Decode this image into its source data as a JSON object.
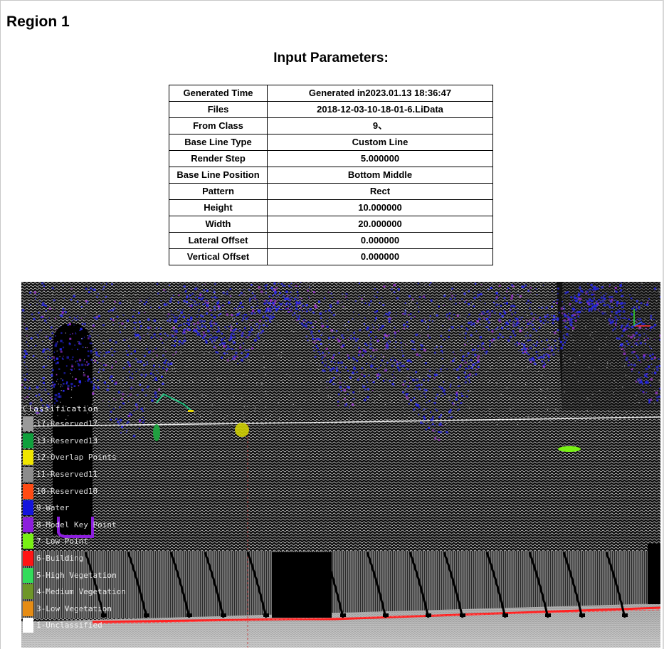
{
  "region": {
    "title": "Region 1"
  },
  "params": {
    "heading": "Input Parameters:",
    "rows": [
      {
        "key": "Generated Time",
        "value": "Generated in2023.01.13 18:36:47"
      },
      {
        "key": "Files",
        "value": "2018-12-03-10-18-01-6.LiData"
      },
      {
        "key": "From Class",
        "value": "9、"
      },
      {
        "key": "Base Line Type",
        "value": "Custom Line"
      },
      {
        "key": "Render Step",
        "value": "5.000000"
      },
      {
        "key": "Base Line Position",
        "value": "Bottom Middle"
      },
      {
        "key": "Pattern",
        "value": "Rect"
      },
      {
        "key": "Height",
        "value": "10.000000"
      },
      {
        "key": "Width",
        "value": "20.000000"
      },
      {
        "key": "Lateral Offset",
        "value": "0.000000"
      },
      {
        "key": "Vertical Offset",
        "value": "0.000000"
      }
    ]
  },
  "viewer": {
    "legend": {
      "title": "Classification",
      "items": [
        {
          "label": "17-Reserved17",
          "color": "#9a9a9a"
        },
        {
          "label": "13-Reserved13",
          "color": "#0fa03c"
        },
        {
          "label": "12-Overlap Points",
          "color": "#f0e600"
        },
        {
          "label": "11-Reserved11",
          "color": "#8c8c8c"
        },
        {
          "label": "10-Reserved10",
          "color": "#ff4b14"
        },
        {
          "label": "9-Water",
          "color": "#1414dc"
        },
        {
          "label": "8-Model Key Point",
          "color": "#8c1edc"
        },
        {
          "label": "7-Low Point",
          "color": "#78f014"
        },
        {
          "label": "6-Building",
          "color": "#ff1414"
        },
        {
          "label": "5-High Vegetation",
          "color": "#32dc5a"
        },
        {
          "label": "4-Medium Vegetation",
          "color": "#6e9628"
        },
        {
          "label": "3-Low Vegetation",
          "color": "#e68c14"
        },
        {
          "label": "1-Unclassified",
          "color": "#ffffff"
        }
      ]
    },
    "colors": {
      "background": "#000000",
      "vegetation": "#2828e6",
      "vegetation_accent": "#9632c8",
      "road_points": "#d8d8d8",
      "curb_line": "#ff2020",
      "axis_x": "#ff3030",
      "axis_y": "#30e030",
      "axis_z": "#3060ff"
    }
  }
}
